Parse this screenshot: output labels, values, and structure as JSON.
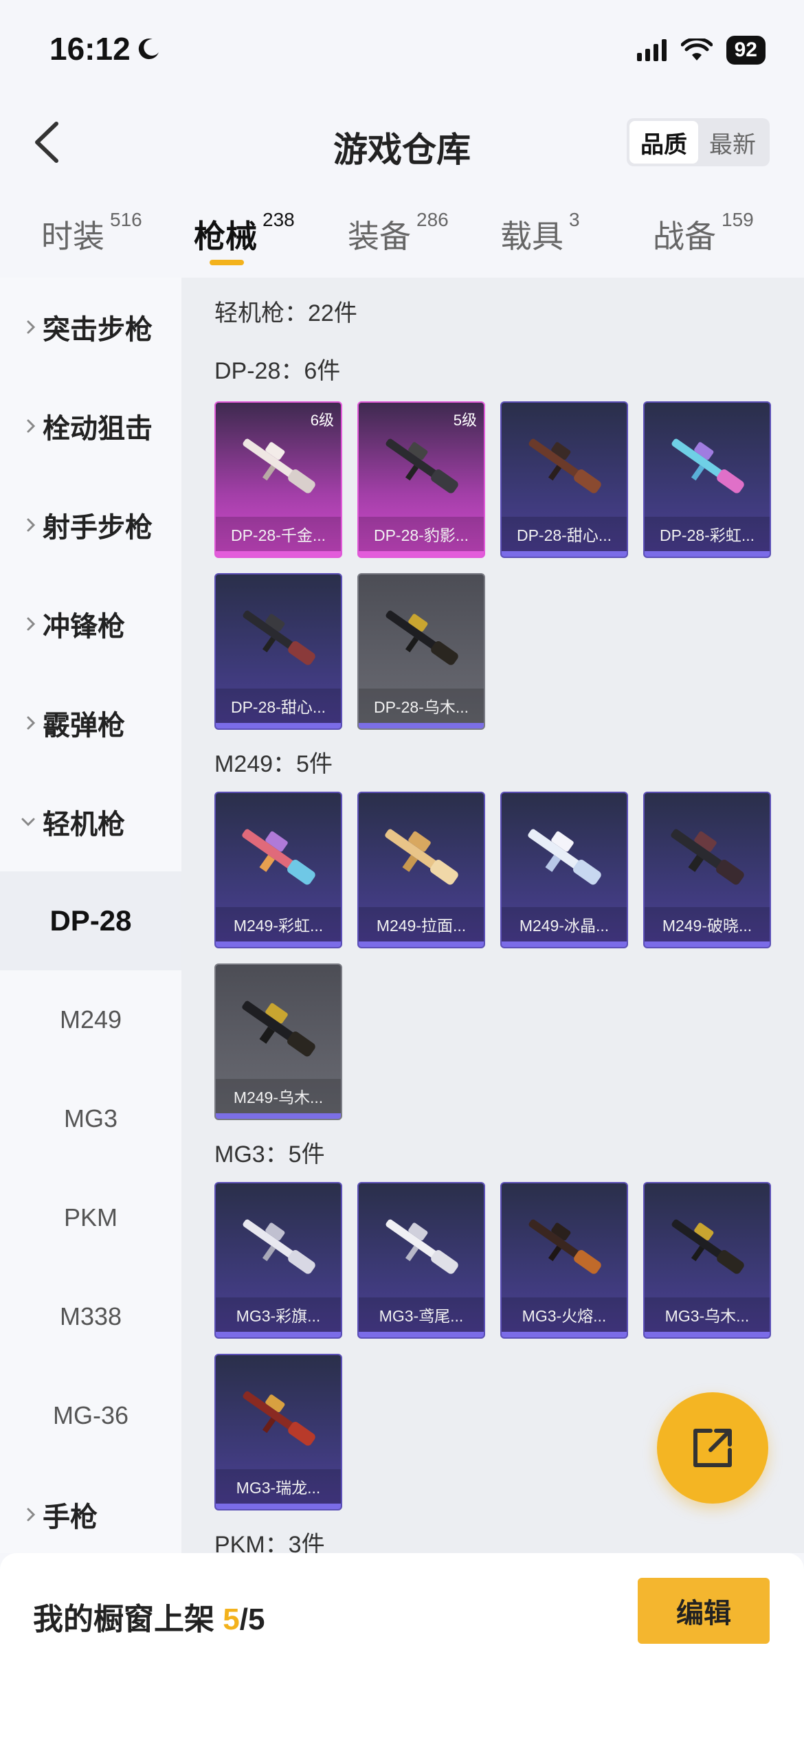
{
  "status": {
    "time": "16:12",
    "battery": "92"
  },
  "header": {
    "title": "游戏仓库",
    "sort_options": [
      "品质",
      "最新"
    ]
  },
  "tabs": [
    {
      "label": "时装",
      "count": "516"
    },
    {
      "label": "枪械",
      "count": "238"
    },
    {
      "label": "装备",
      "count": "286"
    },
    {
      "label": "载具",
      "count": "3"
    },
    {
      "label": "战备",
      "count": "159"
    }
  ],
  "sidebar": {
    "categories": [
      "突击步枪",
      "栓动狙击",
      "射手步枪",
      "冲锋枪",
      "霰弹枪",
      "轻机枪",
      "手枪"
    ],
    "subitems": [
      "DP-28",
      "M249",
      "MG3",
      "PKM",
      "M338",
      "MG-36"
    ]
  },
  "content": {
    "summary": "轻机枪：22件",
    "groups": [
      {
        "title": "DP-28：6件",
        "items": [
          {
            "name": "DP-28-千金...",
            "level": "6级"
          },
          {
            "name": "DP-28-豹影...",
            "level": "5级"
          },
          {
            "name": "DP-28-甜心..."
          },
          {
            "name": "DP-28-彩虹..."
          },
          {
            "name": "DP-28-甜心..."
          },
          {
            "name": "DP-28-乌木..."
          }
        ]
      },
      {
        "title": "M249：5件",
        "items": [
          {
            "name": "M249-彩虹..."
          },
          {
            "name": "M249-拉面..."
          },
          {
            "name": "M249-冰晶..."
          },
          {
            "name": "M249-破晓..."
          },
          {
            "name": "M249-乌木..."
          }
        ]
      },
      {
        "title": "MG3：5件",
        "items": [
          {
            "name": "MG3-彩旗..."
          },
          {
            "name": "MG3-鸢尾..."
          },
          {
            "name": "MG3-火熔..."
          },
          {
            "name": "MG3-乌木..."
          },
          {
            "name": "MG3-瑞龙..."
          }
        ]
      },
      {
        "title": "PKM：3件"
      }
    ]
  },
  "bottom": {
    "shelf_label": "我的橱窗上架 ",
    "shelf_current": "5",
    "shelf_total": "/5",
    "edit_label": "编辑"
  },
  "colors": {
    "accent": "#f3b21c",
    "card_purple": "#d54bd0",
    "card_blue": "#4d3f96",
    "card_gray": "#5f6068"
  }
}
